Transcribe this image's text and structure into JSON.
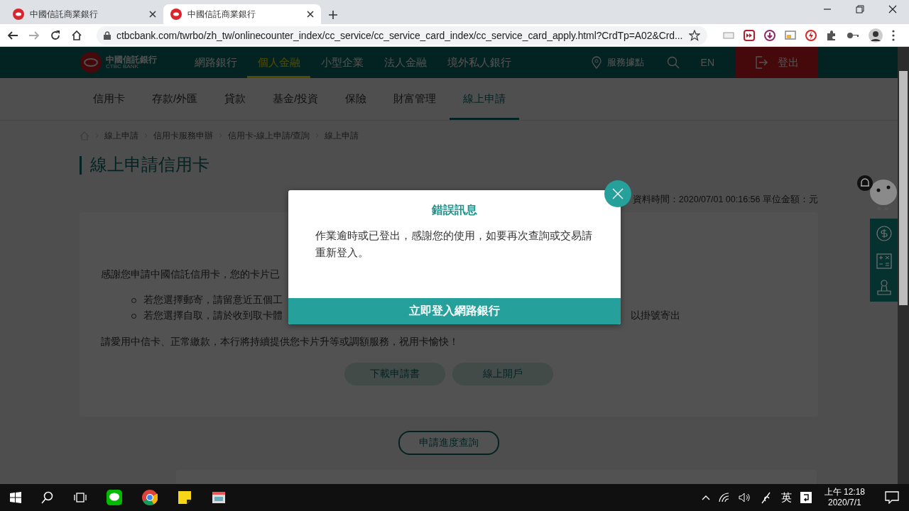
{
  "browser": {
    "tabs": [
      {
        "title": "中國信託商業銀行",
        "selected": false
      },
      {
        "title": "中國信託商業銀行",
        "selected": true
      }
    ],
    "url": "ctbcbank.com/twrbo/zh_tw/onlinecounter_index/cc_service/cc_service_card_index/cc_service_card_apply.html?CrdTp=A02&Crd..."
  },
  "header": {
    "logo_name": "中國信託銀行",
    "logo_sub": "CTBC BANK",
    "nav": [
      {
        "label": "網路銀行",
        "selected": false
      },
      {
        "label": "個人金融",
        "selected": true
      },
      {
        "label": "小型企業",
        "selected": false
      },
      {
        "label": "法人金融",
        "selected": false
      },
      {
        "label": "境外私人銀行",
        "selected": false
      }
    ],
    "service_points": "服務據點",
    "language": "EN",
    "logout": "登出"
  },
  "subnav": [
    {
      "label": "信用卡",
      "selected": false
    },
    {
      "label": "存款/外匯",
      "selected": false
    },
    {
      "label": "貸款",
      "selected": false
    },
    {
      "label": "基金/投資",
      "selected": false
    },
    {
      "label": "保險",
      "selected": false
    },
    {
      "label": "財富管理",
      "selected": false
    },
    {
      "label": "線上申請",
      "selected": true
    }
  ],
  "breadcrumb": [
    "線上申請",
    "信用卡服務申辦",
    "信用卡-線上申請/查詢",
    "線上申請"
  ],
  "page_title": "線上申請信用卡",
  "data_time": "資料時間：2020/07/01 00:16:56 單位金額：元",
  "card": {
    "intro": "感謝您申請中國信託信用卡，您的卡片已",
    "bullets": [
      {
        "text": "若您選擇郵寄，請留意近五個工"
      },
      {
        "text": "若您選擇自取，請於收到取卡體",
        "tail": "以掛號寄出"
      }
    ],
    "closing": "請愛用中信卡、正常繳款，本行將持續提供您卡片升等或調額服務，祝用卡愉快！",
    "buttons": [
      "下載申請書",
      "線上開戶"
    ]
  },
  "progress_button": "申請進度查詢",
  "dialog": {
    "title": "錯誤訊息",
    "message": "作業逾時或已登出，感謝您的使用，如要再次查詢或交易請重新登入。",
    "action": "立即登入網路銀行"
  },
  "taskbar": {
    "ime": "英",
    "time": "上午 12:18",
    "date": "2020/7/1"
  }
}
